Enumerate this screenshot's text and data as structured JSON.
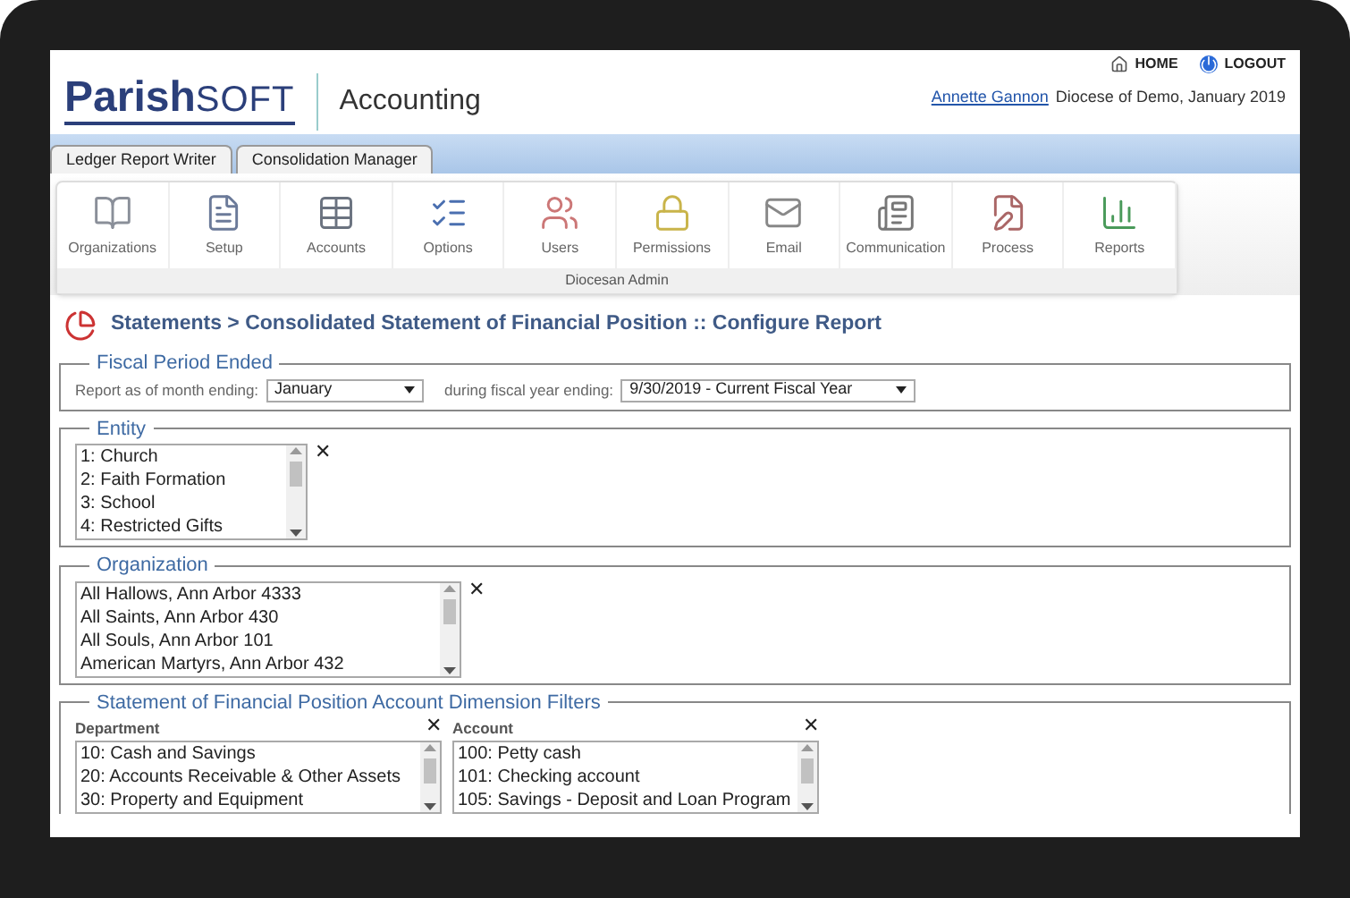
{
  "header": {
    "logo": {
      "brand_left": "Parish",
      "brand_right": "SOFT"
    },
    "app_title": "Accounting",
    "top_links": [
      {
        "label": "HOME"
      },
      {
        "label": "LOGOUT"
      }
    ],
    "user_link": "Annette Gannon",
    "user_context": "Diocese of Demo, January 2019"
  },
  "tabs": [
    {
      "label": "Ledger Report Writer",
      "selected": false
    },
    {
      "label": "Consolidation Manager",
      "selected": false
    }
  ],
  "toolbar": {
    "items": [
      {
        "label": "Organizations"
      },
      {
        "label": "Setup"
      },
      {
        "label": "Accounts"
      },
      {
        "label": "Options"
      },
      {
        "label": "Users"
      },
      {
        "label": "Permissions"
      },
      {
        "label": "Email"
      },
      {
        "label": "Communication"
      },
      {
        "label": "Process"
      },
      {
        "label": "Reports"
      }
    ],
    "group_label": "Diocesan Admin"
  },
  "page_title": "Statements > Consolidated Statement of Financial Position :: Configure Report",
  "fiscal_period": {
    "legend": "Fiscal Period Ended",
    "month_label": "Report as of month ending:",
    "month_value": "January",
    "year_label": "during fiscal year ending:",
    "year_value": "9/30/2019 - Current Fiscal Year"
  },
  "entity": {
    "legend": "Entity",
    "options": [
      "1: Church",
      "2: Faith Formation",
      "3: School",
      "4: Restricted Gifts"
    ],
    "clear": "✕"
  },
  "organization": {
    "legend": "Organization",
    "options": [
      "All Hallows, Ann Arbor 4333",
      "All Saints, Ann Arbor 430",
      "All Souls, Ann Arbor 101",
      "American Martyrs, Ann Arbor 432"
    ],
    "clear": "✕"
  },
  "filters": {
    "legend": "Statement of Financial Position Account Dimension Filters",
    "lists": [
      {
        "label": "Department",
        "clear": "✕",
        "options": [
          "10: Cash and Savings",
          "20: Accounts Receivable & Other Assets",
          "30: Property and Equipment"
        ]
      },
      {
        "label": "Account",
        "clear": "✕",
        "options": [
          "100: Petty cash",
          "101: Checking account",
          "105: Savings - Deposit and Loan Program"
        ]
      }
    ]
  }
}
